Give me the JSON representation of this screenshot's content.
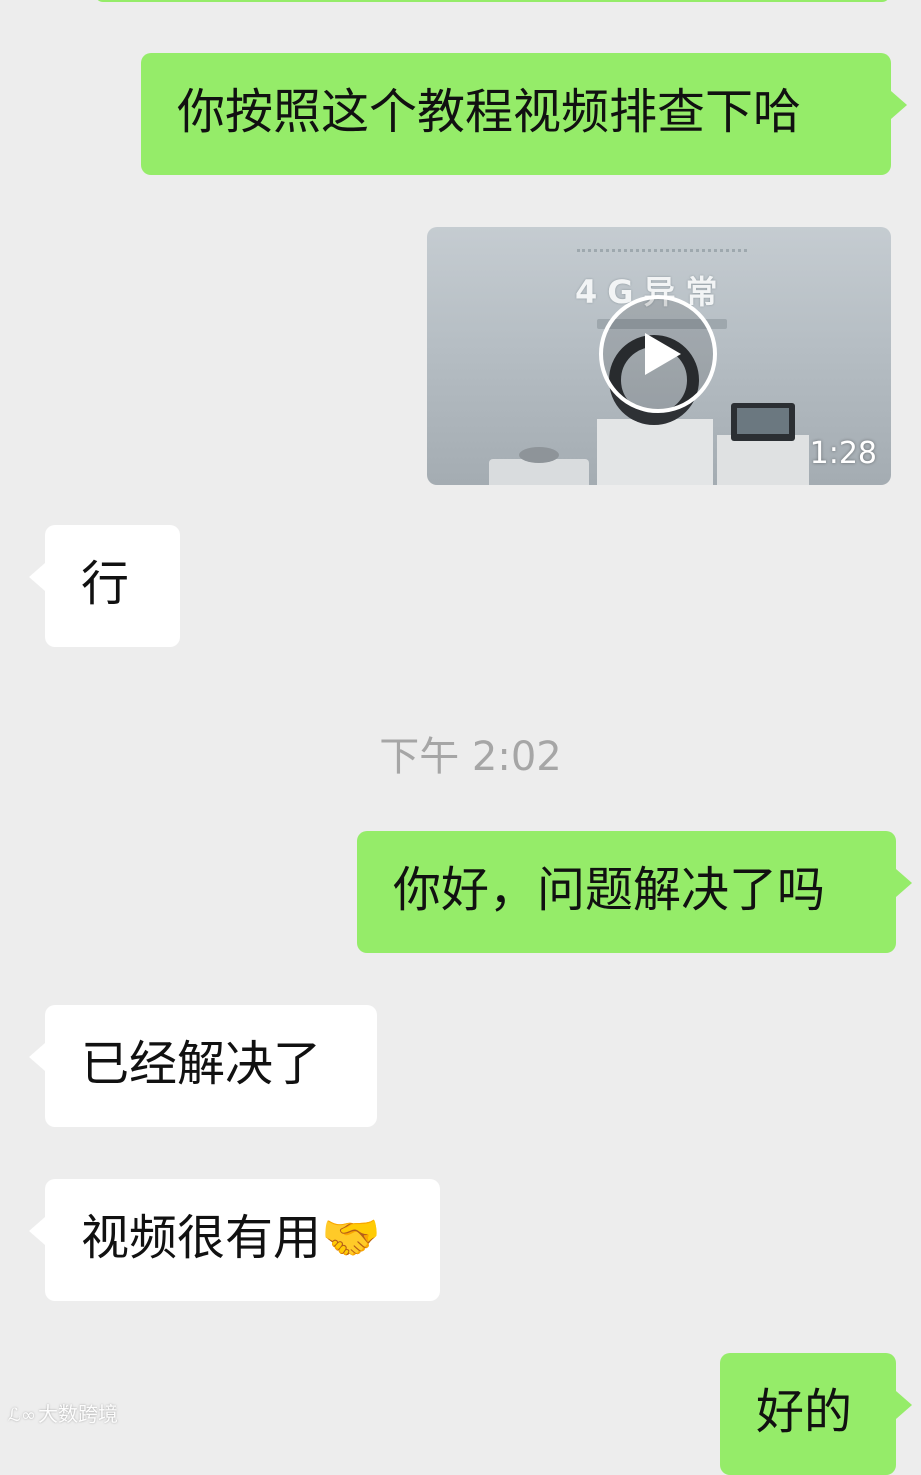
{
  "chat": {
    "messages": [
      {
        "side": "out",
        "text": "你按照这个教程视频排查下哈"
      },
      {
        "side": "out",
        "type": "video",
        "overlay_title": "4G异常",
        "duration": "1:28"
      },
      {
        "side": "in",
        "text": "行"
      },
      {
        "side": "out",
        "text": "你好，问题解决了吗"
      },
      {
        "side": "in",
        "text": "已经解决了"
      },
      {
        "side": "in",
        "text": "视频很有用🤝"
      },
      {
        "side": "out",
        "text": "好的"
      }
    ],
    "timestamp": "下午 2:02"
  },
  "watermark": {
    "logo": "ℒ∞",
    "text": "大数跨境"
  },
  "colors": {
    "background": "#EDEDED",
    "outgoing_bubble": "#95EC69",
    "incoming_bubble": "#FFFFFF",
    "timestamp_text": "#A6A6A6"
  },
  "icons": {
    "play": "play-icon"
  }
}
